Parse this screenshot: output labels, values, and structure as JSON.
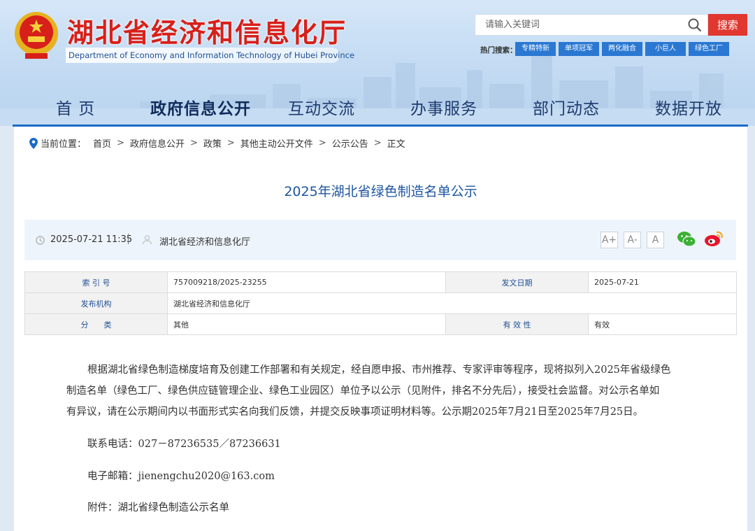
{
  "header": {
    "title": "湖北省经济和信息化厅",
    "subtitle": "Department of Economy and Information Technology of Hubei Province",
    "search_placeholder": "请输入关键词",
    "search_button": "搜索",
    "hot_label": "热门搜索：",
    "hot_tags": [
      "专精特新",
      "单项冠军",
      "两化融合",
      "小巨人",
      "绿色工厂"
    ]
  },
  "nav": {
    "items": [
      "首 页",
      "政府信息公开",
      "互动交流",
      "办事服务",
      "部门动态",
      "数据开放"
    ],
    "active": "政府信息公开"
  },
  "breadcrumb": {
    "label": "当前位置：",
    "items": [
      "首页",
      "政府信息公开",
      "政策",
      "其他主动公开文件",
      "公示公告",
      "正文"
    ],
    "separator": ">"
  },
  "article": {
    "title": "2025年湖北省绿色制造名单公示",
    "date": "2025-07-21 11:35",
    "source": "湖北省经济和信息化厅",
    "font_buttons": [
      "A+",
      "A-",
      "A"
    ],
    "meta": {
      "index_label": "索 引 号",
      "index_value": "757009218/2025-23255",
      "date_label": "发文日期",
      "date_value": "2025-07-21",
      "org_label": "发布机构",
      "org_value": "湖北省经济和信息化厅",
      "category_label": "分　　类",
      "category_value": "其他",
      "validity_label": "有 效 性",
      "validity_value": "有效"
    },
    "paragraph_lines": [
      "根据湖北省绿色制造梯度培育及创建工作部署和有关规定，经自愿申报、市州推荐、专家评审等程序，现将拟列入2025年省级绿色",
      "制造名单（绿色工厂、绿色供应链管理企业、绿色工业园区）单位予以公示（见附件，排名不分先后），接受社会监督。对公示名单如",
      "有异议，请在公示期间内以书面形式实名向我们反馈，并提交反映事项证明材料等。公示期2025年7月21日至2025年7月25日。"
    ],
    "phone": "联系电话：027－87236535／87236631",
    "email": "电子邮箱：jienengchu2020@163.com",
    "attachment": "附件：湖北省绿色制造公示名单"
  },
  "colors": {
    "title_red": "#d7201a",
    "nav_blue": "#1d3b6e",
    "accent_blue": "#1a6bc6",
    "search_red": "#e1372f"
  },
  "icons": [
    "national-emblem-icon",
    "search-icon",
    "location-pin-icon",
    "clock-icon",
    "people-icon",
    "wechat-icon",
    "weibo-icon"
  ]
}
